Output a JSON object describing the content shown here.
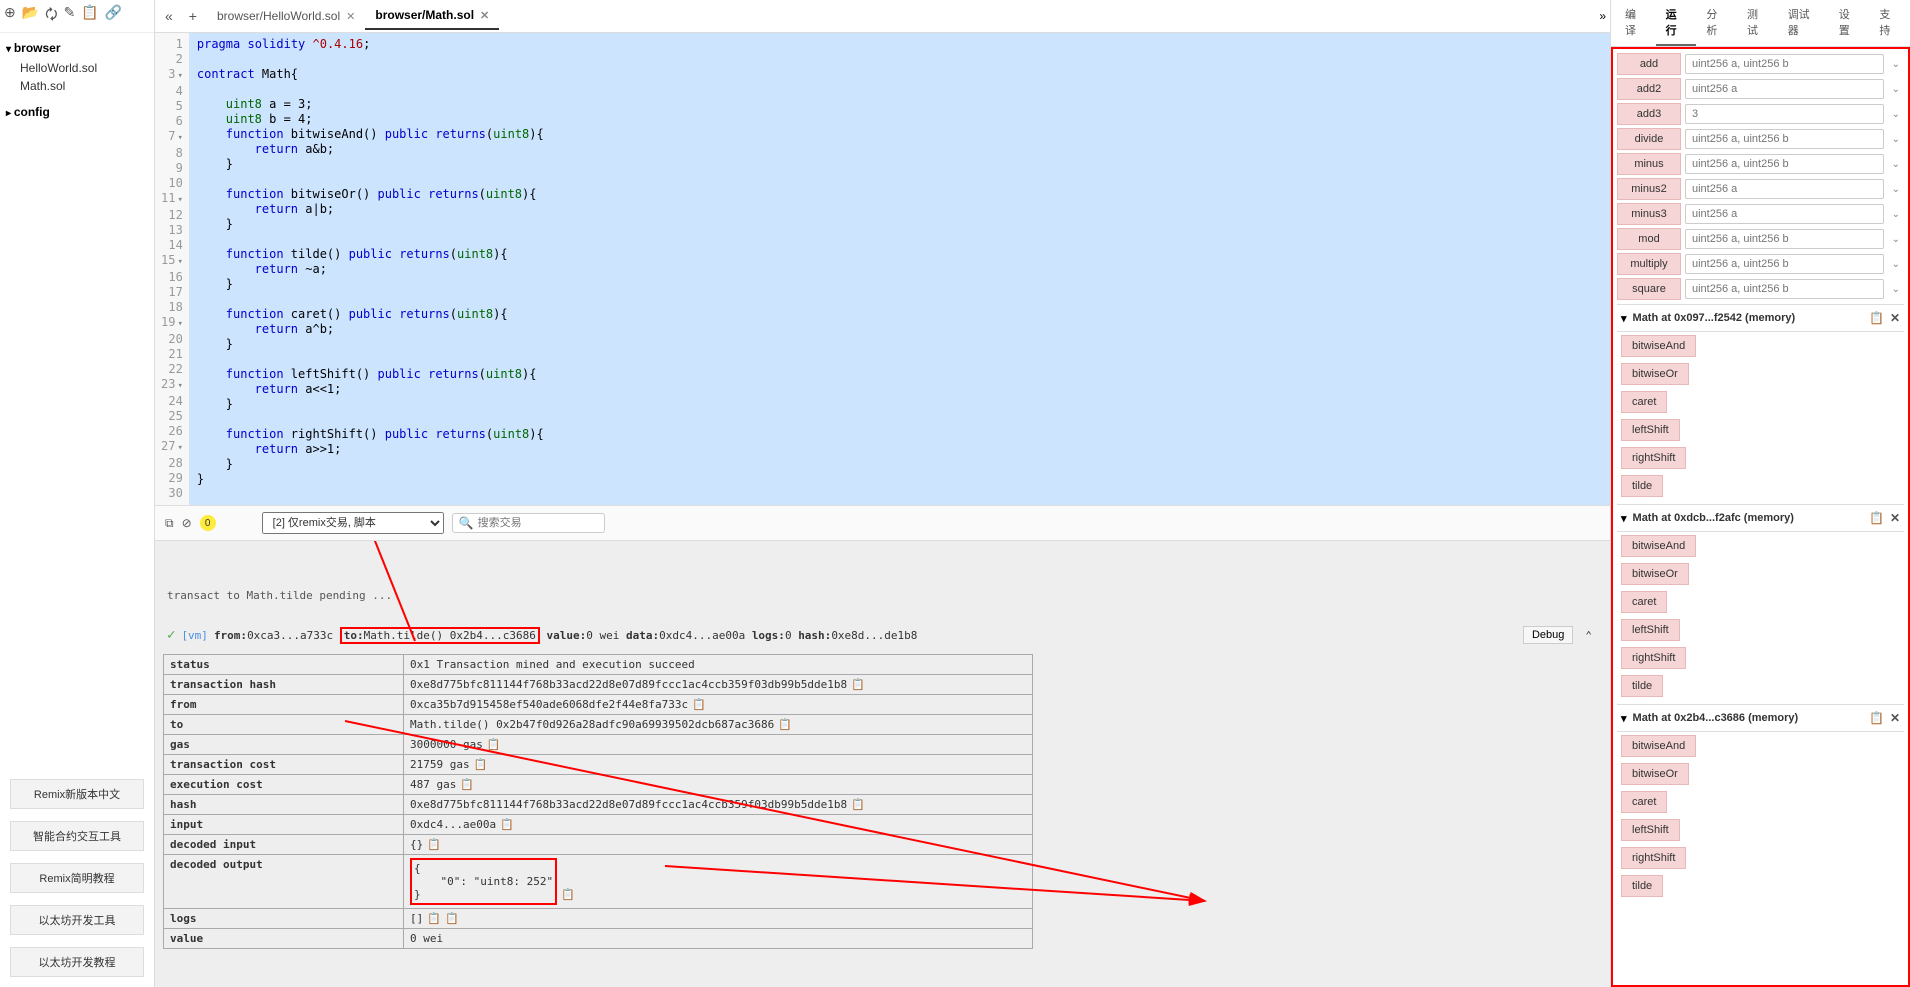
{
  "file_tree": {
    "folders": [
      {
        "name": "browser",
        "open": true,
        "files": [
          "HelloWorld.sol",
          "Math.sol"
        ]
      },
      {
        "name": "config",
        "open": false,
        "files": []
      }
    ]
  },
  "tabs": [
    {
      "label": "browser/HelloWorld.sol",
      "active": false
    },
    {
      "label": "browser/Math.sol",
      "active": true
    }
  ],
  "code_lines": [
    {
      "n": 1,
      "fold": false,
      "text": "pragma solidity ^0.4.16;"
    },
    {
      "n": 2,
      "fold": false,
      "text": ""
    },
    {
      "n": 3,
      "fold": true,
      "text": "contract Math{"
    },
    {
      "n": 4,
      "fold": false,
      "text": ""
    },
    {
      "n": 5,
      "fold": false,
      "text": "    uint8 a = 3;"
    },
    {
      "n": 6,
      "fold": false,
      "text": "    uint8 b = 4;"
    },
    {
      "n": 7,
      "fold": true,
      "text": "    function bitwiseAnd() public returns(uint8){"
    },
    {
      "n": 8,
      "fold": false,
      "text": "        return a&b;"
    },
    {
      "n": 9,
      "fold": false,
      "text": "    }"
    },
    {
      "n": 10,
      "fold": false,
      "text": ""
    },
    {
      "n": 11,
      "fold": true,
      "text": "    function bitwiseOr() public returns(uint8){"
    },
    {
      "n": 12,
      "fold": false,
      "text": "        return a|b;"
    },
    {
      "n": 13,
      "fold": false,
      "text": "    }"
    },
    {
      "n": 14,
      "fold": false,
      "text": ""
    },
    {
      "n": 15,
      "fold": true,
      "text": "    function tilde() public returns(uint8){"
    },
    {
      "n": 16,
      "fold": false,
      "text": "        return ~a;"
    },
    {
      "n": 17,
      "fold": false,
      "text": "    }"
    },
    {
      "n": 18,
      "fold": false,
      "text": ""
    },
    {
      "n": 19,
      "fold": true,
      "text": "    function caret() public returns(uint8){"
    },
    {
      "n": 20,
      "fold": false,
      "text": "        return a^b;"
    },
    {
      "n": 21,
      "fold": false,
      "text": "    }"
    },
    {
      "n": 22,
      "fold": false,
      "text": ""
    },
    {
      "n": 23,
      "fold": true,
      "text": "    function leftShift() public returns(uint8){"
    },
    {
      "n": 24,
      "fold": false,
      "text": "        return a<<1;"
    },
    {
      "n": 25,
      "fold": false,
      "text": "    }"
    },
    {
      "n": 26,
      "fold": false,
      "text": ""
    },
    {
      "n": 27,
      "fold": true,
      "text": "    function rightShift() public returns(uint8){"
    },
    {
      "n": 28,
      "fold": false,
      "text": "        return a>>1;"
    },
    {
      "n": 29,
      "fold": false,
      "text": "    }"
    },
    {
      "n": 30,
      "fold": false,
      "text": "}"
    }
  ],
  "console_bar": {
    "badge": "0",
    "select_label": "[2] 仅remix交易, 脚本",
    "search_placeholder": "搜索交易"
  },
  "console": {
    "pending": "transact to Math.tilde pending ...",
    "vm_tag": "[vm]",
    "tx_from_label": "from:",
    "tx_from": "0xca3...a733c",
    "tx_to_label": "to:",
    "tx_to": "Math.tilde() 0x2b4...c3686",
    "tx_value_label": "value:",
    "tx_value": "0 wei",
    "tx_data_label": "data:",
    "tx_data": "0xdc4...ae00a",
    "tx_logs_label": "logs:",
    "tx_logs": "0",
    "tx_hash_label": "hash:",
    "tx_hash": "0xe8d...de1b8",
    "debug": "Debug"
  },
  "tx_table": [
    {
      "k": "status",
      "v": "0x1 Transaction mined and execution succeed"
    },
    {
      "k": "transaction hash",
      "v": "0xe8d775bfc811144f768b33acd22d8e07d89fccc1ac4ccb359f03db99b5dde1b8",
      "copy": true
    },
    {
      "k": "from",
      "v": "0xca35b7d915458ef540ade6068dfe2f44e8fa733c",
      "copy": true
    },
    {
      "k": "to",
      "v": "Math.tilde() 0x2b47f0d926a28adfc90a69939502dcb687ac3686",
      "copy": true
    },
    {
      "k": "gas",
      "v": "3000000 gas",
      "copy": true
    },
    {
      "k": "transaction cost",
      "v": "21759 gas",
      "copy": true
    },
    {
      "k": "execution cost",
      "v": "487 gas",
      "copy": true
    },
    {
      "k": "hash",
      "v": "0xe8d775bfc811144f768b33acd22d8e07d89fccc1ac4ccb359f03db99b5dde1b8",
      "copy": true
    },
    {
      "k": "input",
      "v": "0xdc4...ae00a",
      "copy": true
    },
    {
      "k": "decoded input",
      "v": "{}",
      "copy": true
    },
    {
      "k": "decoded output",
      "v": "{\n    \"0\": \"uint8: 252\"\n}",
      "copy": true,
      "red": true
    },
    {
      "k": "logs",
      "v": "[]",
      "copy": true,
      "copy2": true
    },
    {
      "k": "value",
      "v": "0 wei"
    }
  ],
  "footer_links": [
    "Remix新版本中文",
    "智能合约交互工具",
    "Remix简明教程",
    "以太坊开发工具",
    "以太坊开发教程"
  ],
  "right_tabs": [
    "编译",
    "运行",
    "分析",
    "测试",
    "调试器",
    "设置",
    "支持"
  ],
  "right_tabs_active": 1,
  "input_functions": [
    {
      "name": "add",
      "placeholder": "uint256 a, uint256 b"
    },
    {
      "name": "add2",
      "placeholder": "uint256 a"
    },
    {
      "name": "add3",
      "placeholder": "3"
    },
    {
      "name": "divide",
      "placeholder": "uint256 a, uint256 b"
    },
    {
      "name": "minus",
      "placeholder": "uint256 a, uint256 b"
    },
    {
      "name": "minus2",
      "placeholder": "uint256 a"
    },
    {
      "name": "minus3",
      "placeholder": "uint256 a"
    },
    {
      "name": "mod",
      "placeholder": "uint256 a, uint256 b"
    },
    {
      "name": "multiply",
      "placeholder": "uint256 a, uint256 b"
    },
    {
      "name": "square",
      "placeholder": "uint256 a, uint256 b"
    }
  ],
  "instances": [
    {
      "title": "Math at 0x097...f2542 (memory)",
      "fns": [
        "bitwiseAnd",
        "bitwiseOr",
        "caret",
        "leftShift",
        "rightShift",
        "tilde"
      ]
    },
    {
      "title": "Math at 0xdcb...f2afc (memory)",
      "fns": [
        "bitwiseAnd",
        "bitwiseOr",
        "caret",
        "leftShift",
        "rightShift",
        "tilde"
      ]
    },
    {
      "title": "Math at 0x2b4...c3686 (memory)",
      "fns": [
        "bitwiseAnd",
        "bitwiseOr",
        "caret",
        "leftShift",
        "rightShift",
        "tilde"
      ]
    }
  ]
}
